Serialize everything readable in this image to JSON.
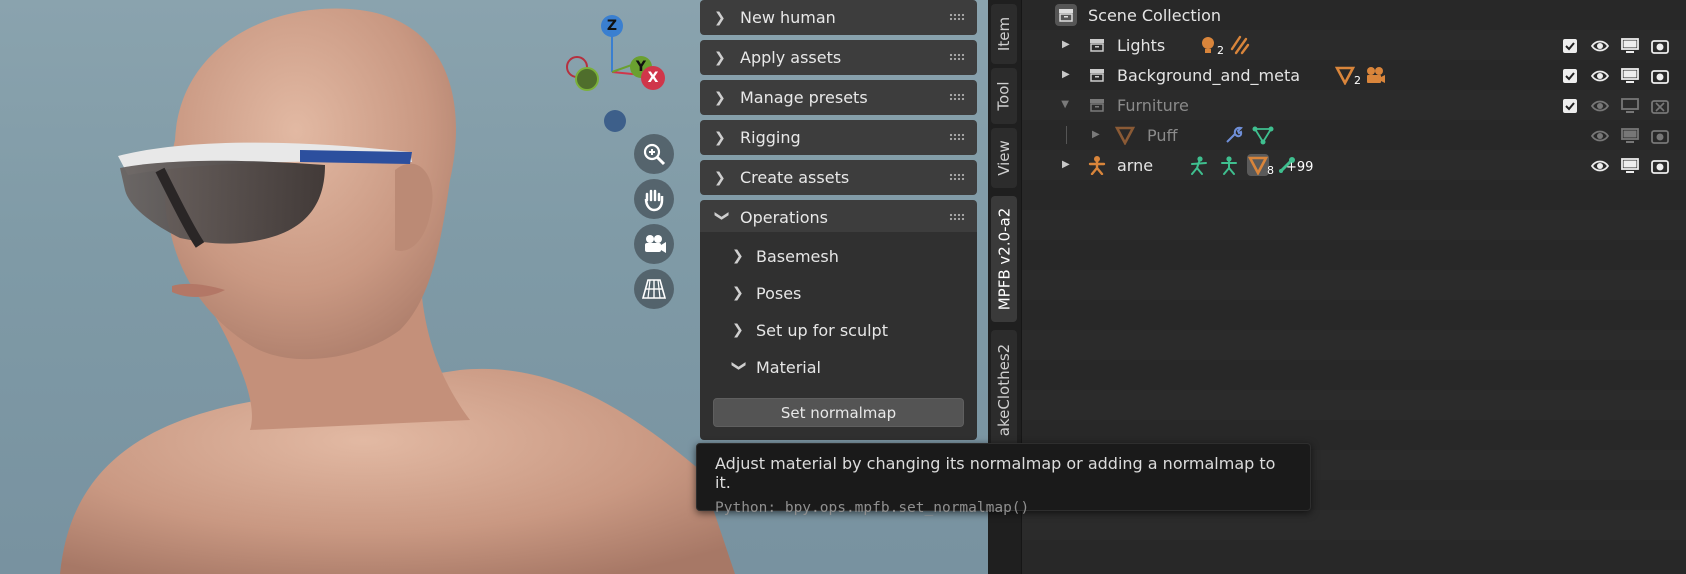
{
  "viewport": {
    "gizmo": {
      "z": "Z",
      "y": "Y",
      "x": "X"
    },
    "nav_buttons": [
      "zoom-icon",
      "hand-pan-icon",
      "camera-icon",
      "grid-perspective-icon"
    ]
  },
  "npanel": {
    "panels": [
      {
        "label": "New human",
        "expanded": false
      },
      {
        "label": "Apply assets",
        "expanded": false
      },
      {
        "label": "Manage presets",
        "expanded": false
      },
      {
        "label": "Rigging",
        "expanded": false
      },
      {
        "label": "Create assets",
        "expanded": false
      },
      {
        "label": "Operations",
        "expanded": true
      }
    ],
    "operations_subpanels": [
      {
        "label": "Basemesh",
        "expanded": false
      },
      {
        "label": "Poses",
        "expanded": false
      },
      {
        "label": "Set up for sculpt",
        "expanded": false
      },
      {
        "label": "Material",
        "expanded": true
      }
    ],
    "set_normalmap_button": "Set normalmap"
  },
  "tabs": [
    {
      "label": "Item",
      "active": false
    },
    {
      "label": "Tool",
      "active": false
    },
    {
      "label": "View",
      "active": false
    },
    {
      "label": "MPFB v2.0-a2",
      "active": true
    },
    {
      "label": "akeClothes2",
      "active": false
    }
  ],
  "tooltip": {
    "description": "Adjust material by changing its normalmap or adding a normalmap to it.",
    "python": "Python: bpy.ops.mpfb.set_normalmap()"
  },
  "outliner": {
    "root": "Scene Collection",
    "rows": [
      {
        "label": "Lights",
        "badge": "2",
        "dim": false
      },
      {
        "label": "Background_and_meta",
        "badge": "2",
        "dim": false
      },
      {
        "label": "Furniture",
        "dim": true
      },
      {
        "label": "Puff",
        "dim": true
      },
      {
        "label": "arne",
        "badge": "8",
        "extra": "+99",
        "dim": false
      }
    ],
    "colors": {
      "collection": "#c8c8c8",
      "object_orange": "#d9853b",
      "modifier_blue": "#6f8fd8",
      "vertex_green": "#3fbf8f"
    }
  }
}
